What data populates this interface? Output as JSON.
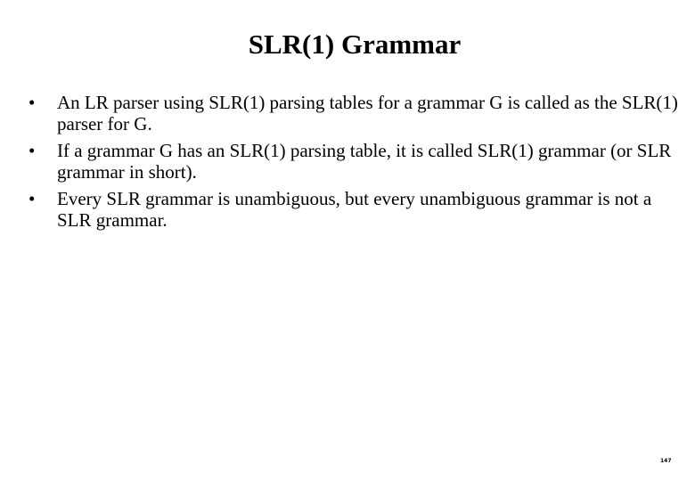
{
  "slide": {
    "title": "SLR(1) Grammar",
    "bullet_icon": "•",
    "bullets": [
      {
        "text": "An LR parser using SLR(1) parsing tables for a grammar G is called as the SLR(1) parser for G."
      },
      {
        "text": "If a grammar G has an SLR(1) parsing table, it is called SLR(1) grammar (or SLR grammar in short)."
      },
      {
        "text": "Every SLR grammar is unambiguous, but every unambiguous grammar is not a SLR grammar."
      }
    ],
    "page_number": "147"
  }
}
